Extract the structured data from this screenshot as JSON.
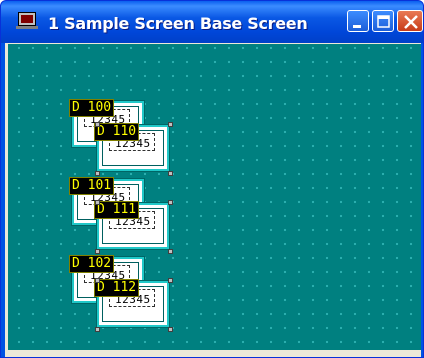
{
  "window": {
    "title": "1 Sample Screen Base Screen"
  },
  "devices": [
    {
      "tag": "D 100",
      "value": "12345"
    },
    {
      "tag": "D 110",
      "value": "12345"
    },
    {
      "tag": "D 101",
      "value": "12345"
    },
    {
      "tag": "D 111",
      "value": "12345"
    },
    {
      "tag": "D 102",
      "value": "12345"
    },
    {
      "tag": "D 112",
      "value": "12345"
    }
  ]
}
